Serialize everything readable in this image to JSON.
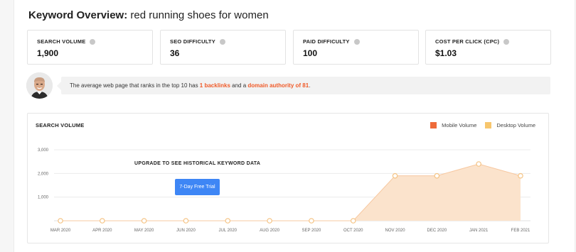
{
  "header": {
    "title_prefix": "Keyword Overview:",
    "keyword": "red running shoes for women"
  },
  "metrics": [
    {
      "label": "SEARCH VOLUME",
      "value": "1,900"
    },
    {
      "label": "SEO DIFFICULTY",
      "value": "36"
    },
    {
      "label": "PAID DIFFICULTY",
      "value": "100"
    },
    {
      "label": "COST PER CLICK (CPC)",
      "value": "$1.03"
    }
  ],
  "info": {
    "text_before": "The average web page that ranks in the top 10 has ",
    "backlinks": "1 backlinks",
    "text_middle": " and a ",
    "domain_authority": "domain authority of 81",
    "text_after": "."
  },
  "chart": {
    "section_title": "SEARCH VOLUME",
    "legend": [
      {
        "label": "Mobile Volume",
        "color": "#ee6b3a"
      },
      {
        "label": "Desktop Volume",
        "color": "#f7c66d"
      }
    ],
    "upgrade_text": "UPGRADE TO SEE HISTORICAL KEYWORD DATA",
    "trial_button": "7-Day Free Trial"
  },
  "chart_data": {
    "type": "area",
    "categories": [
      "MAR 2020",
      "APR 2020",
      "MAY 2020",
      "JUN 2020",
      "JUL 2020",
      "AUG 2020",
      "SEP 2020",
      "OCT 2020",
      "NOV 2020",
      "DEC 2020",
      "JAN 2021",
      "FEB 2021"
    ],
    "series": [
      {
        "name": "Mobile Volume",
        "values": [
          0,
          0,
          0,
          0,
          0,
          0,
          0,
          0,
          0,
          0,
          0,
          0
        ]
      },
      {
        "name": "Desktop Volume",
        "values": [
          0,
          0,
          0,
          0,
          0,
          0,
          0,
          0,
          1900,
          1900,
          2400,
          1900
        ]
      }
    ],
    "yticks": [
      "3,000",
      "2,000",
      "1,000"
    ],
    "ylim": [
      0,
      3000
    ],
    "grid": true,
    "legend_position": "top-right",
    "area_color": "#fbe3cc",
    "line_color": "#f7c8a0",
    "point_color": "#f5c383"
  }
}
